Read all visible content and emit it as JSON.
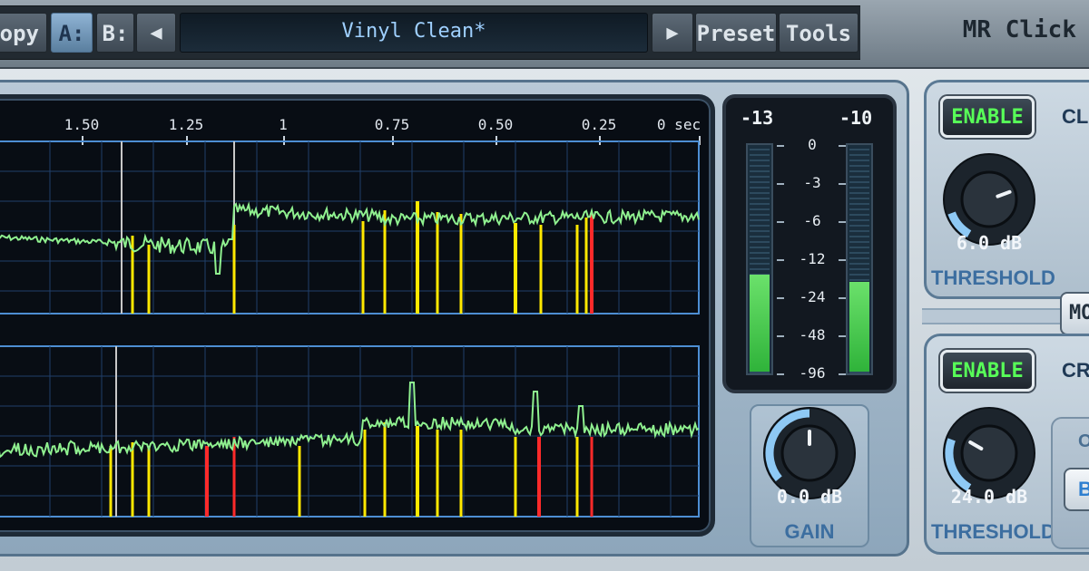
{
  "header": {
    "copy_label": "opy",
    "a_label": "A:",
    "b_label": "B:",
    "prev_label": "◀",
    "preset_name": "Vinyl Clean*",
    "next_label": "▶",
    "preset_menu_label": "Preset",
    "tools_menu_label": "Tools",
    "plugin_name": "MR Click"
  },
  "timeline": {
    "ticks": [
      "1.50",
      "1.25",
      "1",
      "0.75",
      "0.50",
      "0.25",
      "0 sec"
    ]
  },
  "meter": {
    "peak_left": "-13",
    "peak_right": "-10",
    "scale": [
      "0",
      "-3",
      "-6",
      "-12",
      "-24",
      "-48",
      "-96"
    ],
    "level_left": 0.43,
    "level_right": 0.4
  },
  "gain": {
    "value": "0.0 dB",
    "label": "GAIN"
  },
  "click": {
    "enable_label": "ENABLE",
    "title": "CL",
    "threshold_value": "6.0 dB",
    "threshold_label": "THRESHOLD"
  },
  "mode": {
    "label": "MO"
  },
  "crackle": {
    "enable_label": "ENABLE",
    "title": "CR",
    "threshold_value": "24.0 dB",
    "threshold_label": "THRESHOLD",
    "sub_label": "O",
    "sub_button_label": "B"
  },
  "colors": {
    "waveform": "#8ff08f",
    "click_marker": "#ffe800",
    "strong_click_marker": "#ff2a2a",
    "knob_arc": "#8ec9f5",
    "enable_text": "#58ff58"
  }
}
